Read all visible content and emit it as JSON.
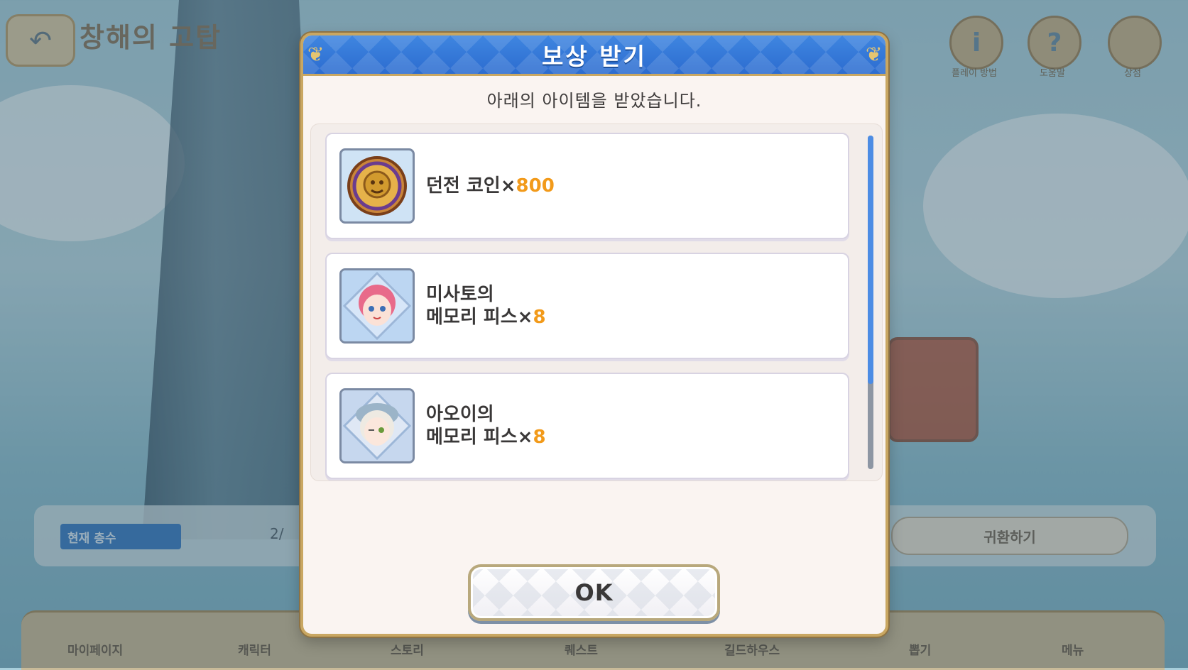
{
  "background": {
    "stage_title": "창해의 고탑",
    "top_icons": [
      {
        "icon": "info-icon",
        "glyph": "i",
        "label": "플레이 방법"
      },
      {
        "icon": "help-icon",
        "glyph": "?",
        "label": "도움말"
      },
      {
        "icon": "shop-icon",
        "glyph": "",
        "label": "상점"
      }
    ],
    "floor_label": "현재 층수",
    "floor_value": "2/",
    "return_label": "귀환하기",
    "nav_items": [
      "마이페이지",
      "캐릭터",
      "스토리",
      "퀘스트",
      "길드하우스",
      "뽑기",
      "메뉴"
    ]
  },
  "dialog": {
    "title": "보상 받기",
    "subtitle": "아래의 아이템을 받았습니다.",
    "ok_label": "OK",
    "items": [
      {
        "name_line1": "던전 코인",
        "name_line2": "",
        "times": "×",
        "quantity": "800",
        "icon": "dungeon-coin-icon"
      },
      {
        "name_line1": "미사토의",
        "name_line2": "메모리 피스",
        "times": "×",
        "quantity": "8",
        "icon": "misato-memory-piece-icon"
      },
      {
        "name_line1": "아오이의",
        "name_line2": "메모리 피스",
        "times": "×",
        "quantity": "8",
        "icon": "aoi-memory-piece-icon"
      }
    ],
    "scroll_position": 0
  },
  "colors": {
    "header_blue": "#2c6cd0",
    "frame_gold": "#c9a762",
    "quantity_orange": "#f29a1a",
    "scroll_thumb": "#4c8ce4"
  }
}
